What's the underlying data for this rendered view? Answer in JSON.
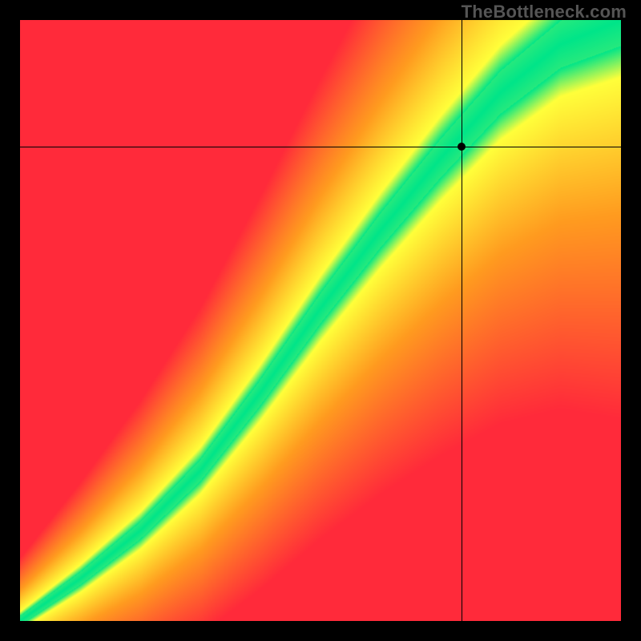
{
  "watermark": "TheBottleneck.com",
  "chart_data": {
    "type": "heatmap",
    "title": "",
    "xlabel": "",
    "ylabel": "",
    "xlim": [
      0,
      100
    ],
    "ylim": [
      0,
      100
    ],
    "crosshair": {
      "x": 73.5,
      "y": 79.0
    },
    "marker": {
      "x": 73.5,
      "y": 79.0
    },
    "optimal_curve": {
      "description": "green ridge from bottom-left to top-right along a slightly concave diagonal",
      "points": [
        {
          "x": 0,
          "y": 0
        },
        {
          "x": 10,
          "y": 7
        },
        {
          "x": 20,
          "y": 15
        },
        {
          "x": 30,
          "y": 25
        },
        {
          "x": 40,
          "y": 38
        },
        {
          "x": 50,
          "y": 52
        },
        {
          "x": 60,
          "y": 65
        },
        {
          "x": 70,
          "y": 77
        },
        {
          "x": 80,
          "y": 88
        },
        {
          "x": 90,
          "y": 96
        },
        {
          "x": 100,
          "y": 100
        }
      ]
    },
    "color_stops": {
      "best": "#00E589",
      "near": "#FFFF3A",
      "mid": "#FF9B1F",
      "bad": "#FF2A3A"
    }
  }
}
